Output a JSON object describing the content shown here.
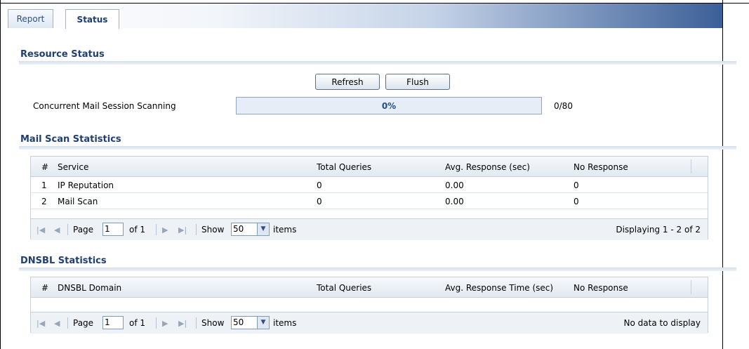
{
  "tabs": [
    {
      "label": "Report",
      "active": false
    },
    {
      "label": "Status",
      "active": true
    }
  ],
  "resource": {
    "title": "Resource Status",
    "refresh_label": "Refresh",
    "flush_label": "Flush",
    "session_label": "Concurrent Mail Session Scanning",
    "progress_text": "0%",
    "progress_value": 0,
    "count": "0/80"
  },
  "mail_scan": {
    "title": "Mail Scan Statistics",
    "columns": [
      "#",
      "Service",
      "Total Queries",
      "Avg. Response (sec)",
      "No Response"
    ],
    "rows": [
      {
        "num": "1",
        "service": "IP Reputation",
        "queries": "0",
        "avg": "0.00",
        "noresp": "0"
      },
      {
        "num": "2",
        "service": "Mail Scan",
        "queries": "0",
        "avg": "0.00",
        "noresp": "0"
      }
    ],
    "pager": {
      "page_label": "Page",
      "page_value": "1",
      "of_label": "of 1",
      "show_label": "Show",
      "show_value": "50",
      "items_label": "items",
      "display_text": "Displaying 1 - 2 of 2"
    }
  },
  "dnsbl": {
    "title": "DNSBL Statistics",
    "columns": [
      "#",
      "DNSBL Domain",
      "Total Queries",
      "Avg. Response Time (sec)",
      "No Response"
    ],
    "pager": {
      "page_label": "Page",
      "page_value": "1",
      "of_label": "of 1",
      "show_label": "Show",
      "show_value": "50",
      "items_label": "items",
      "display_text": "No data to display"
    }
  },
  "colors": {
    "accent": "#1f3f73",
    "tabbar_end": "#3b5f98",
    "progress_bg": "#e6edf6"
  },
  "icons": [
    "first-page-icon",
    "prev-page-icon",
    "next-page-icon",
    "last-page-icon",
    "dropdown-arrow-icon"
  ]
}
